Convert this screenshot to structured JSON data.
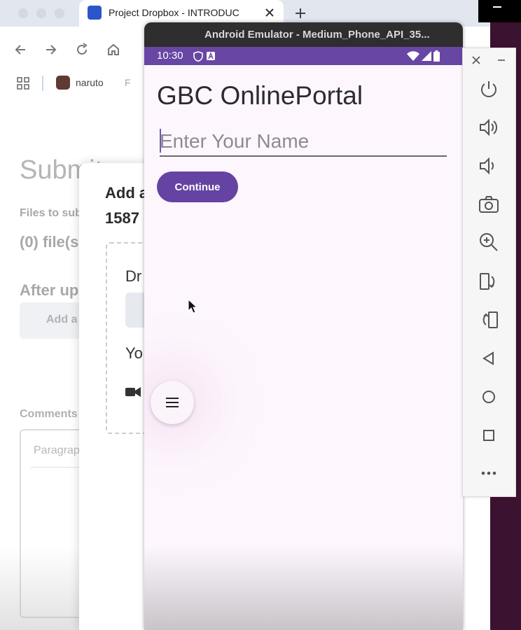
{
  "browser": {
    "tab_title": "Project Dropbox - INTRODUC",
    "bookmark_label": "naruto",
    "bookmark_next": "F"
  },
  "page": {
    "heading": "Submit a",
    "files_label": "Files to sub",
    "file_count": "(0) file(s",
    "after_label": "After up",
    "add_label": "Add a",
    "comments_label": "Comments",
    "comment_placeholder": "Paragrap"
  },
  "modal": {
    "title_line1": "Add a",
    "title_line2": "1587",
    "drop_text": "Dr",
    "you_text": "Yo"
  },
  "emulator": {
    "window_title": "Android Emulator - Medium_Phone_API_35...",
    "status_time": "10:30",
    "app_title": "GBC OnlinePortal",
    "name_placeholder": "Enter Your Name",
    "continue_label": "Continue"
  },
  "side_panel": {
    "buttons": [
      "power",
      "volume-up",
      "volume-down",
      "camera",
      "zoom",
      "rotate-left",
      "rotate-right",
      "back",
      "home",
      "overview",
      "more"
    ]
  },
  "colors": {
    "status_bar": "#6746a4",
    "button": "#6543a3",
    "app_bg": "#fdf7fd"
  }
}
